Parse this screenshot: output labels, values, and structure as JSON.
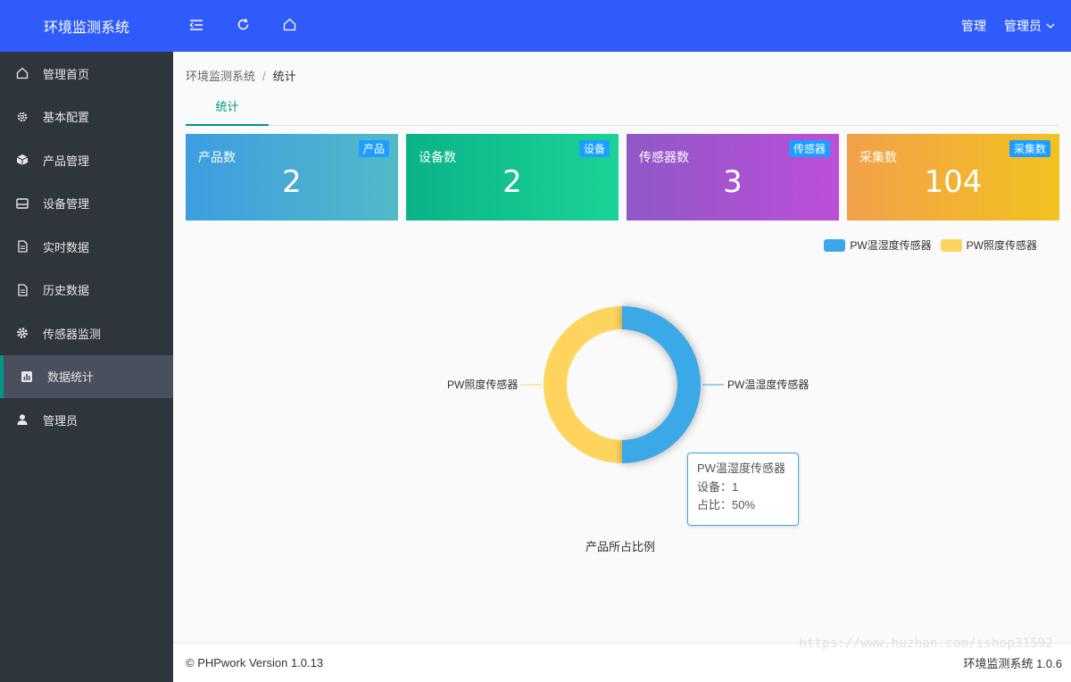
{
  "app": {
    "title": "环境监测系统"
  },
  "sidebar": {
    "items": [
      {
        "label": "管理首页",
        "icon": "home-icon"
      },
      {
        "label": "基本配置",
        "icon": "gear-icon"
      },
      {
        "label": "产品管理",
        "icon": "cube-icon"
      },
      {
        "label": "设备管理",
        "icon": "device-icon"
      },
      {
        "label": "实时数据",
        "icon": "document-icon"
      },
      {
        "label": "历史数据",
        "icon": "document-icon"
      },
      {
        "label": "传感器监测",
        "icon": "cog-icon"
      },
      {
        "label": "数据统计",
        "icon": "bar-chart-icon",
        "active": true
      },
      {
        "label": "管理员",
        "icon": "user-icon"
      }
    ]
  },
  "header": {
    "buttons": [
      "menu-toggle-icon",
      "refresh-icon",
      "home-icon"
    ],
    "manage_label": "管理",
    "user_label": "管理员"
  },
  "breadcrumb": {
    "root": "环境监测系统",
    "separator": "/",
    "current": "统计"
  },
  "tabs": [
    {
      "label": "统计"
    }
  ],
  "cards": [
    {
      "title": "产品数",
      "value": "2",
      "badge": "产品"
    },
    {
      "title": "设备数",
      "value": "2",
      "badge": "设备"
    },
    {
      "title": "传感器数",
      "value": "3",
      "badge": "传感器"
    },
    {
      "title": "采集数",
      "value": "104",
      "badge": "采集数"
    }
  ],
  "chart_data": {
    "type": "pie",
    "title": "产品所占比例",
    "labels": [
      "PW温湿度传感器",
      "PW照度传感器"
    ],
    "values": [
      1,
      1
    ],
    "colors": [
      "#3aa8e8",
      "#ffd45e"
    ],
    "legend_position": "top-right"
  },
  "tooltip": {
    "name": "PW温湿度传感器",
    "line1": "设备：1",
    "line2": "占比：50%"
  },
  "footer": {
    "copyright": "© PHPwork Version 1.0.13",
    "version": "环境监测系统 1.0.6"
  },
  "watermark": "https://www.huzhan.com/ishop31592"
}
